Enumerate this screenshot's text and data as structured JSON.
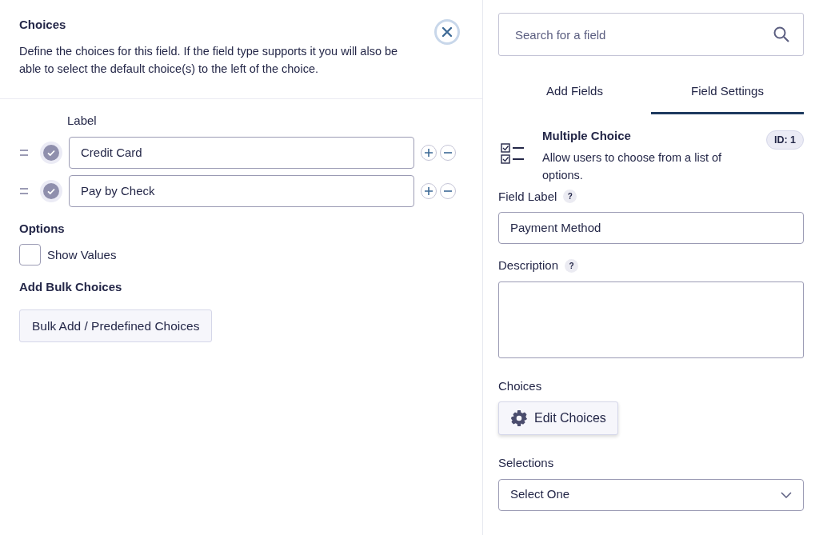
{
  "choices_panel": {
    "title": "Choices",
    "description": "Define the choices for this field. If the field type supports it you will also be able to select the default choice(s) to the left of the choice.",
    "column_label": "Label",
    "choices": [
      {
        "value": "Credit Card",
        "selected": false
      },
      {
        "value": "Pay by Check",
        "selected": false
      }
    ],
    "options_heading": "Options",
    "show_values": {
      "label": "Show Values",
      "checked": false
    },
    "bulk_heading": "Add Bulk Choices",
    "bulk_button": "Bulk Add / Predefined Choices"
  },
  "sidebar": {
    "search": {
      "placeholder": "Search for a field"
    },
    "tabs": [
      {
        "label": "Add Fields",
        "selected": false
      },
      {
        "label": "Field Settings",
        "selected": true
      }
    ],
    "field_type": {
      "name": "Multiple Choice",
      "description": "Allow users to choose from a list of options.",
      "id_badge": "ID: 1"
    },
    "field_label": {
      "label": "Field Label",
      "help": "?",
      "value": "Payment Method"
    },
    "description": {
      "label": "Description",
      "help": "?"
    },
    "choices": {
      "label": "Choices",
      "button": "Edit Choices"
    },
    "selections": {
      "label": "Selections",
      "value": "Select One"
    }
  }
}
